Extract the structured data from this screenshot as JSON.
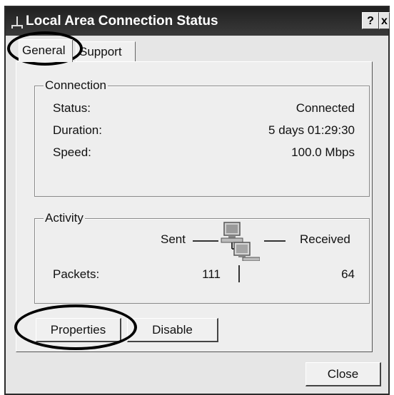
{
  "window": {
    "title": "Local Area Connection Status",
    "help_button": "?",
    "close_button": "x"
  },
  "tabs": [
    {
      "label": "General",
      "active": true
    },
    {
      "label": "Support",
      "active": false
    }
  ],
  "connection": {
    "legend": "Connection",
    "rows": [
      {
        "label": "Status:",
        "value": "Connected"
      },
      {
        "label": "Duration:",
        "value": "5 days 01:29:30"
      },
      {
        "label": "Speed:",
        "value": "100.0 Mbps"
      }
    ]
  },
  "activity": {
    "legend": "Activity",
    "sent_label": "Sent",
    "received_label": "Received",
    "packets_label": "Packets:",
    "packets_sent": "111",
    "packets_received": "64",
    "icon": "network-computers-icon"
  },
  "buttons": {
    "properties": "Properties",
    "disable": "Disable",
    "close": "Close"
  },
  "colors": {
    "titlebar": "#2a2a2a",
    "dialog_bg": "#eeeeee",
    "annotation": "#000000"
  }
}
